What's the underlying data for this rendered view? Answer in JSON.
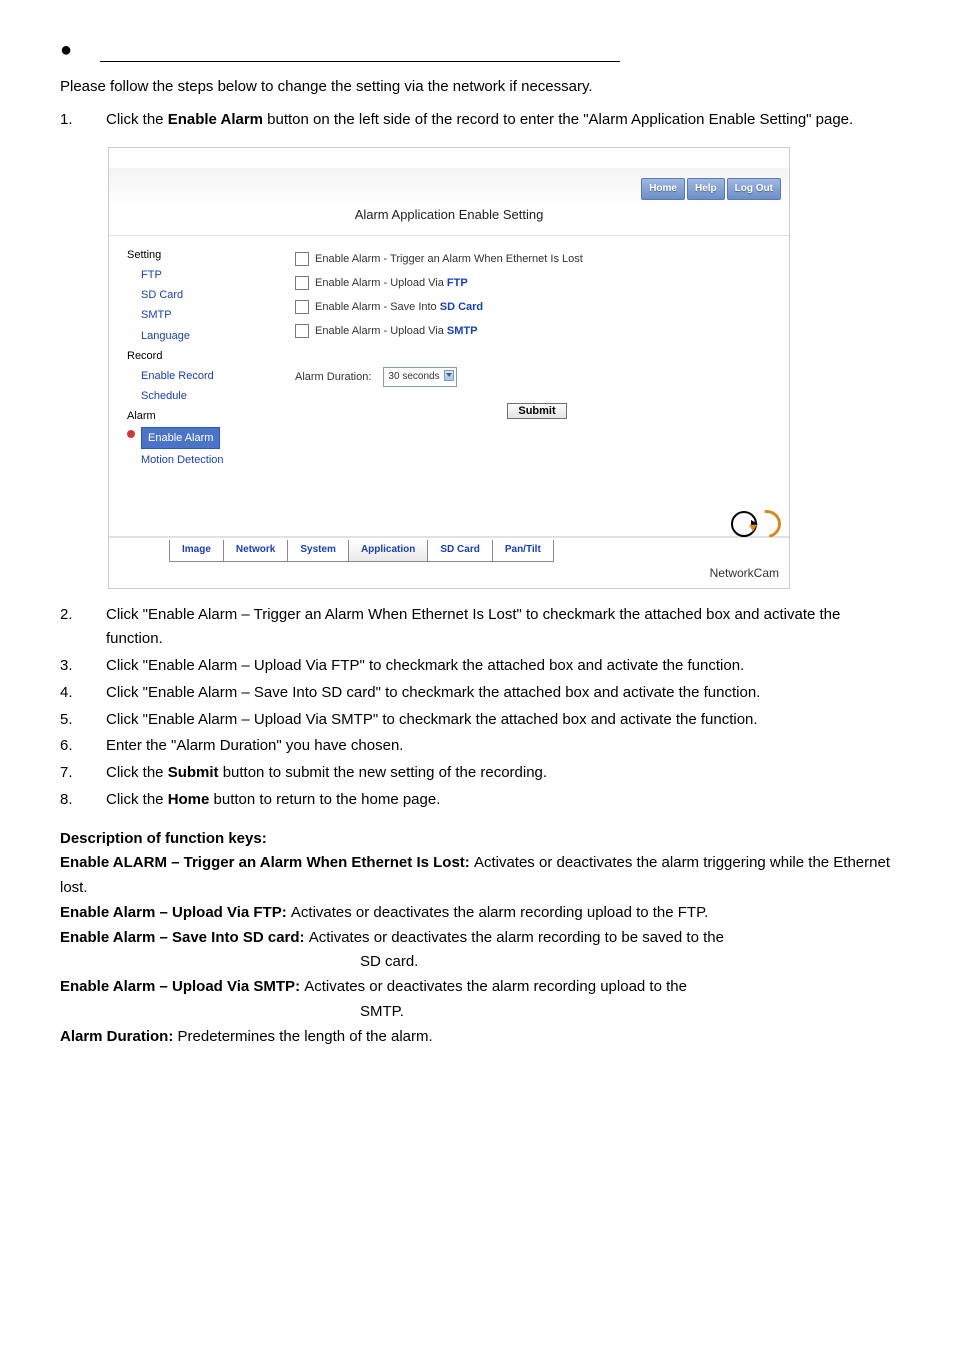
{
  "doc": {
    "intro": "Please follow the steps below to change the setting via the network if necessary.",
    "steps": {
      "s1a": "Click the ",
      "s1b": "Enable Alarm",
      "s1c": " button on the left side of the record to enter the \"Alarm Application Enable Setting\" page.",
      "s2": "Click \"Enable Alarm – Trigger an Alarm When Ethernet Is Lost\" to checkmark the attached box and activate the function.",
      "s3": "Click \"Enable Alarm – Upload Via FTP\" to checkmark the attached box and activate the function.",
      "s4": "Click \"Enable Alarm – Save Into SD card\" to checkmark the attached box and activate the function.",
      "s5": "Click \"Enable Alarm – Upload Via SMTP\" to checkmark the attached box and activate the function.",
      "s6": "Enter the \"Alarm Duration\" you have chosen.",
      "s7a": "Click the ",
      "s7b": "Submit",
      "s7c": " button to submit the new setting of the recording.",
      "s8a": "Click the ",
      "s8b": "Home",
      "s8c": " button to return to the home page."
    },
    "desc_head": "Description of function keys:",
    "kv1k": "Enable ALARM – Trigger an Alarm When Ethernet Is Lost: ",
    "kv1v": "Activates or deactivates the alarm triggering while the Ethernet lost.",
    "kv2k": "Enable Alarm – Upload Via FTP: ",
    "kv2v": "Activates or deactivates the alarm recording upload to the FTP.",
    "kv3k": "Enable Alarm – Save Into SD card: ",
    "kv3v": "Activates or deactivates the alarm recording to be saved to the ",
    "kv3v2": "SD card.",
    "kv4k": "Enable Alarm – Upload Via SMTP: ",
    "kv4v": "Activates or deactivates the alarm recording upload to the ",
    "kv4v2": "SMTP.",
    "kv5k": "Alarm Duration: ",
    "kv5v": "Predetermines the length of the alarm."
  },
  "shot": {
    "topbtns": {
      "home": "Home",
      "help": "Help",
      "logout": "Log Out"
    },
    "title": "Alarm Application Enable Setting",
    "side": {
      "setting": "Setting",
      "ftp": "FTP",
      "sdcard": "SD Card",
      "smtp": "SMTP",
      "language": "Language",
      "record": "Record",
      "enable_record": "Enable Record",
      "schedule": "Schedule",
      "alarm": "Alarm",
      "enable_alarm": "Enable Alarm",
      "motion": "Motion Detection"
    },
    "checks": {
      "c1a": "Enable Alarm - Trigger an Alarm When Ethernet Is Lost",
      "c2a": "Enable Alarm - Upload Via ",
      "c2b": "FTP",
      "c3a": "Enable Alarm - Save Into ",
      "c3b": "SD Card",
      "c4a": "Enable Alarm - Upload Via ",
      "c4b": "SMTP"
    },
    "duration_label": "Alarm Duration:",
    "duration_value": "30 seconds",
    "submit": "Submit",
    "tabs": {
      "image": "Image",
      "network": "Network",
      "system": "System",
      "application": "Application",
      "sdcard": "SD Card",
      "pantilt": "Pan/Tilt"
    },
    "footer": "NetworkCam"
  }
}
